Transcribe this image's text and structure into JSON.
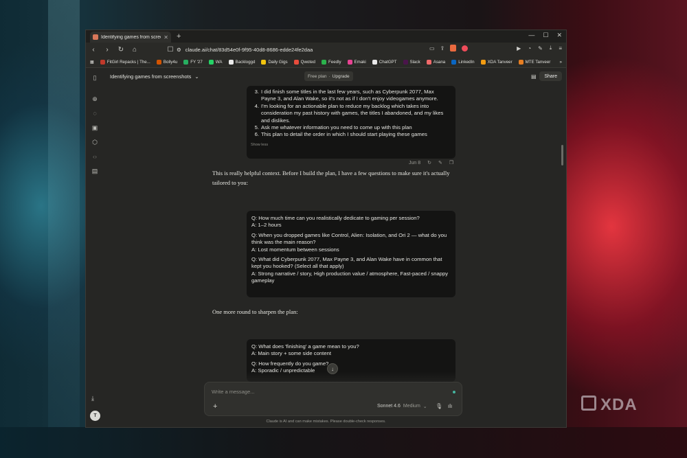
{
  "browser": {
    "tab_title": "Identifying games from screenshots",
    "url": "claude.ai/chat/83d54e0f-9f95-40d8-8686-edde24fe2daa",
    "window_controls": [
      "—",
      "☐",
      "✕"
    ],
    "bookmarks": [
      {
        "label": "FitGirl Repacks | The...",
        "color": "#c0392b"
      },
      {
        "label": "Bolly4u",
        "color": "#d35400"
      },
      {
        "label": "FY '27",
        "color": "#27ae60"
      },
      {
        "label": "WA",
        "color": "#25d366"
      },
      {
        "label": "Backloggd",
        "color": "#eaeaea"
      },
      {
        "label": "Daily Gigs",
        "color": "#f1c40f"
      },
      {
        "label": "Qwoted",
        "color": "#e74c3c"
      },
      {
        "label": "Feedly",
        "color": "#2bb24c"
      },
      {
        "label": "Emaki",
        "color": "#e84393"
      },
      {
        "label": "ChatGPT",
        "color": "#e8e8e8"
      },
      {
        "label": "Slack",
        "color": "#4a154b"
      },
      {
        "label": "Asana",
        "color": "#f06a6a"
      },
      {
        "label": "LinkedIn",
        "color": "#0a66c2"
      },
      {
        "label": "XDA Tanveer",
        "color": "#f39c12"
      },
      {
        "label": "MTE Tanveer",
        "color": "#e67e22"
      }
    ],
    "bookmarks_more": "»"
  },
  "header": {
    "chat_title": "Identifying games from screenshots",
    "plan_label": "Free plan",
    "plan_separator": "·",
    "upgrade_label": "Upgrade",
    "share_label": "Share"
  },
  "user_message": {
    "items": [
      {
        "n": "3.",
        "text": "I did finish some titles in the last few years, such as Cyberpunk 2077, Max Payne 3, and Alan Wake, so it's not as if I don't enjoy videogames anymore."
      },
      {
        "n": "4.",
        "text": "I'm looking for an actionable plan to reduce my backlog which takes into consideration my past history with games, the titles I abandoned, and my likes and dislikes."
      },
      {
        "n": "5.",
        "text": "Ask me whatever information you need to come up with this plan"
      },
      {
        "n": "6.",
        "text": "This plan to detail the order in which I should start playing these games"
      }
    ],
    "show_less": "Show less",
    "date": "Jun 8"
  },
  "assistant_1": "This is really helpful context. Before I build the plan, I have a few questions to make sure it's actually tailored to you:",
  "qa_block_1": [
    {
      "q": "Q: How much time can you realistically dedicate to gaming per session?",
      "a": "A: 1–2 hours"
    },
    {
      "q": "Q: When you dropped games like Control, Alien: Isolation, and Ori 2 — what do you think was the main reason?",
      "a": "A: Lost momentum between sessions"
    },
    {
      "q": "Q: What did Cyberpunk 2077, Max Payne 3, and Alan Wake have in common that kept you hooked? (Select all that apply)",
      "a": "A: Strong narrative / story, High production value / atmosphere, Fast-paced / snappy gameplay"
    }
  ],
  "assistant_2": "One more round to sharpen the plan:",
  "qa_block_2": [
    {
      "q": "Q: What does 'finishing' a game mean to you?",
      "a": "A: Main story + some side content"
    },
    {
      "q": "Q: How frequently do you game?",
      "a": "A: Sporadic / unpredictable"
    }
  ],
  "composer": {
    "placeholder": "Write a message...",
    "model": "Sonnet 4.6",
    "mode": "Medium"
  },
  "disclaimer": "Claude is AI and can make mistakes. Please double-check responses.",
  "avatar_initial": "T",
  "watermark": "XDA"
}
